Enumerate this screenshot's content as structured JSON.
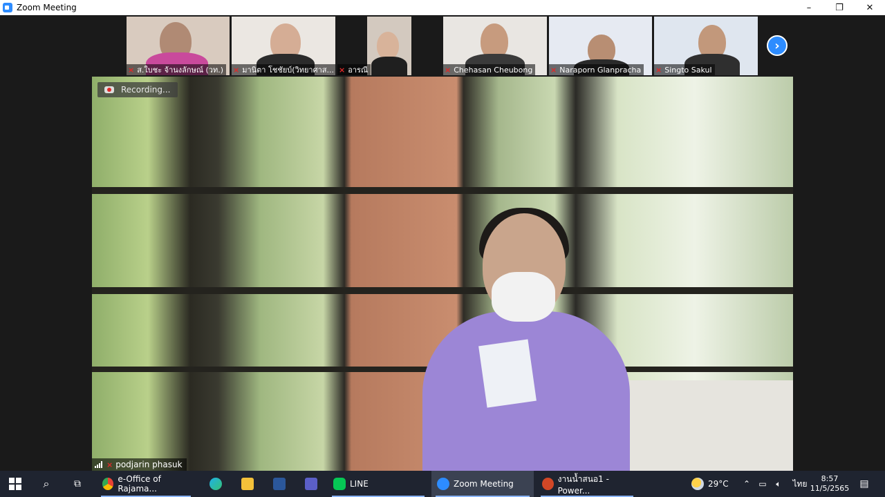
{
  "window": {
    "title": "Zoom Meeting",
    "minimize": "–",
    "restore": "❐",
    "close": "✕"
  },
  "participants": [
    {
      "name": "ส.ใบชะ จ้านงลักษณ์ (วท.)",
      "bg": "#d9cbbf",
      "head": "#b08a74",
      "body": "#c94a9c"
    },
    {
      "name": "มานิตา โชชัยบ์(วิทยาศาส...",
      "bg": "#ebe7e2",
      "head": "#d5ad95",
      "body": "#2b2b2b"
    },
    {
      "name": "อารณี",
      "bg": "#d3c9bf",
      "head": "#d8b39a",
      "body": "#1f1f1f"
    },
    {
      "name": "Chehasan Cheubong",
      "bg": "#e9e6e2",
      "head": "#c79b7e",
      "body": "#3a3a3a"
    },
    {
      "name": "Naraporn Glanpracha",
      "bg": "#e6eaf2",
      "head": "#b88e73",
      "body": "#2a2a2a"
    },
    {
      "name": "Singto Sakul",
      "bg": "#dfe6ef",
      "head": "#c2987b",
      "body": "#2f2f2f"
    }
  ],
  "next_page_icon": "chevron-right-icon",
  "main_video": {
    "recording_label": "Recording...",
    "speaker_name": "podjarin phasuk"
  },
  "taskbar": {
    "chrome_label": "e-Office of Rajama...",
    "line_label": "LINE",
    "zoom_label": "Zoom Meeting",
    "ppt_label": "งานน้ำสนอ1 - Power...",
    "weather": "29°C",
    "language": "ไทย",
    "time": "8:57",
    "date": "11/5/2565"
  },
  "colors": {
    "zoom_blue": "#2D8CFF",
    "mute_red": "#e02828",
    "taskbar": "#1f2430"
  }
}
